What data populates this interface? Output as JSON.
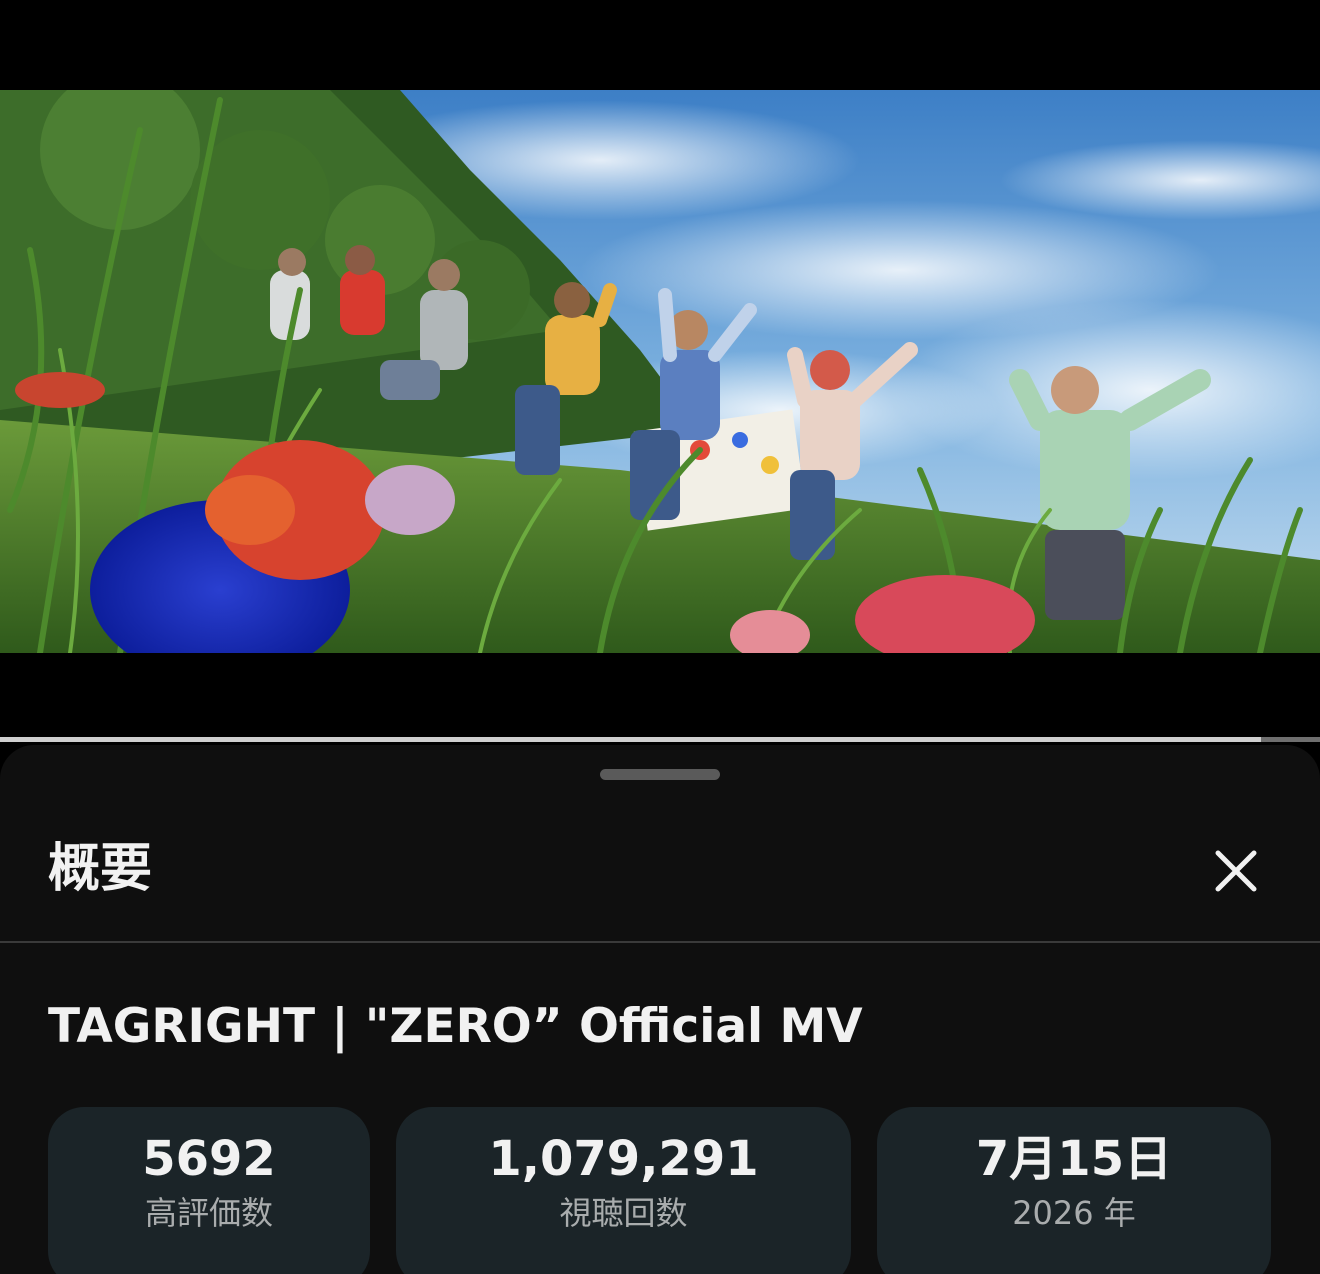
{
  "sheet": {
    "title": "概要",
    "close_icon": "close-icon"
  },
  "video": {
    "title": "TAGRIGHT | \"ZERO” Official MV",
    "progress": 0.955
  },
  "stats": [
    {
      "value": "5692",
      "label": "高評価数"
    },
    {
      "value": "1,079,291",
      "label": "視聴回数"
    },
    {
      "value": "7月15日",
      "label": "2026 年"
    }
  ],
  "colors": {
    "sheet_bg": "#0f0f0f",
    "card_bg": "#1b2428",
    "text": "#f1f1f1",
    "muted_text": "#a9acad"
  }
}
